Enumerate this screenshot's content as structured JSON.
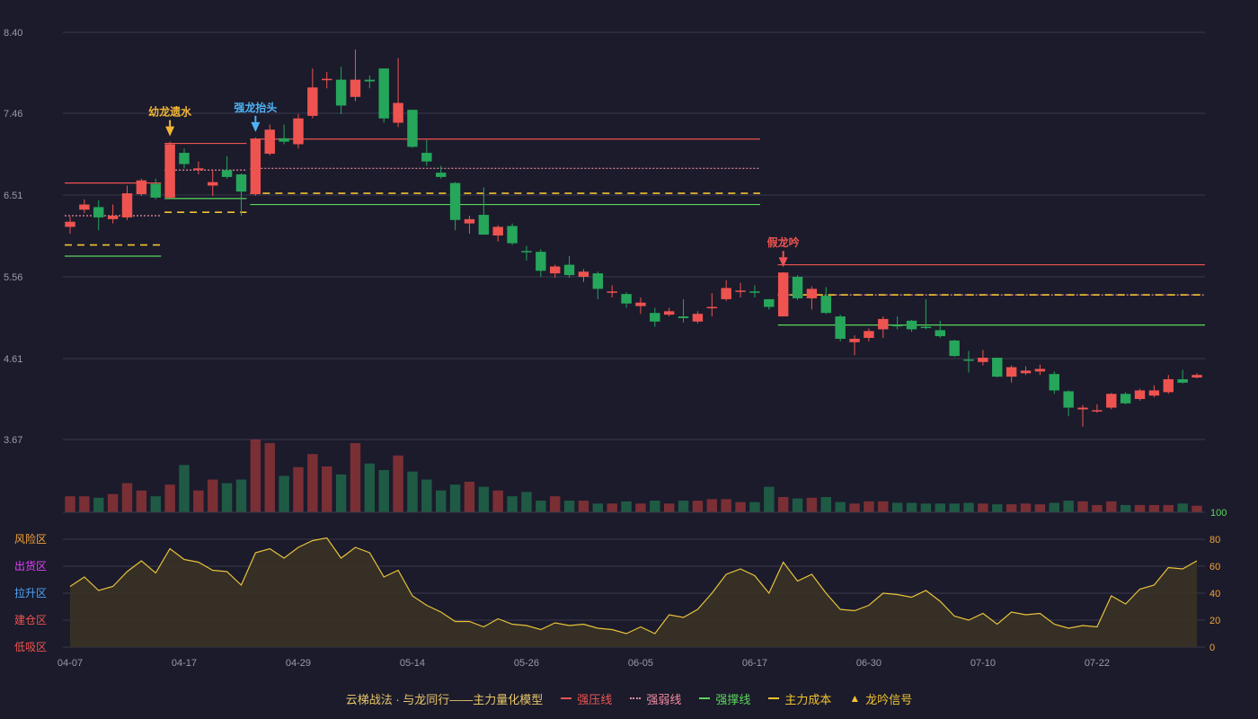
{
  "colors": {
    "bg": "#1b1b2b",
    "grid": "#3a3a4c",
    "up": "#ef5350",
    "down": "#26a65b",
    "vol_up": "#7a2f35",
    "vol_down": "#1f5a45",
    "pressure": "#ef5350",
    "weak": "#f08aa0",
    "support": "#5cd65c",
    "cost": "#f2c230",
    "osc_line": "#e8c23a",
    "osc_fill": "#3a3326",
    "signal_orange": "#f2b535",
    "signal_blue": "#4fb3f6",
    "signal_red": "#ef5350"
  },
  "chart_data": {
    "type": "candlestick",
    "x_ticks": [
      {
        "i": 0,
        "label": "04-07"
      },
      {
        "i": 8,
        "label": "04-17"
      },
      {
        "i": 16,
        "label": "04-29"
      },
      {
        "i": 24,
        "label": "05-14"
      },
      {
        "i": 32,
        "label": "05-26"
      },
      {
        "i": 40,
        "label": "06-05"
      },
      {
        "i": 48,
        "label": "06-17"
      },
      {
        "i": 56,
        "label": "06-30"
      },
      {
        "i": 64,
        "label": "07-10"
      },
      {
        "i": 72,
        "label": "07-22"
      }
    ],
    "price_axis": {
      "ticks": [
        "8.40",
        "7.46",
        "6.51",
        "5.56",
        "4.61",
        "3.67"
      ],
      "min": 3.67,
      "max": 8.4
    },
    "candles": [
      [
        6.14,
        6.2,
        6.26,
        6.06
      ],
      [
        6.34,
        6.4,
        6.46,
        6.3
      ],
      [
        6.37,
        6.25,
        6.45,
        6.1
      ],
      [
        6.23,
        6.27,
        6.4,
        6.18
      ],
      [
        6.25,
        6.53,
        6.62,
        6.22
      ],
      [
        6.52,
        6.68,
        6.7,
        6.5
      ],
      [
        6.64,
        6.48,
        6.7,
        6.46
      ],
      [
        6.48,
        7.1,
        7.13,
        6.47
      ],
      [
        7.0,
        6.87,
        7.05,
        6.82
      ],
      [
        6.8,
        6.82,
        6.9,
        6.75
      ],
      [
        6.62,
        6.66,
        6.8,
        6.5
      ],
      [
        6.8,
        6.72,
        6.96,
        6.7
      ],
      [
        6.75,
        6.55,
        6.76,
        6.27
      ],
      [
        6.52,
        7.16,
        7.18,
        6.5
      ],
      [
        6.99,
        7.27,
        7.33,
        6.97
      ],
      [
        7.17,
        7.13,
        7.33,
        7.1
      ],
      [
        7.1,
        7.4,
        7.45,
        7.05
      ],
      [
        7.43,
        7.76,
        7.98,
        7.4
      ],
      [
        7.85,
        7.86,
        7.94,
        7.75
      ],
      [
        7.85,
        7.55,
        8.0,
        7.45
      ],
      [
        7.65,
        7.85,
        8.2,
        7.6
      ],
      [
        7.85,
        7.83,
        7.9,
        7.75
      ],
      [
        7.98,
        7.4,
        7.98,
        7.35
      ],
      [
        7.35,
        7.58,
        8.1,
        7.3
      ],
      [
        7.5,
        7.07,
        7.5,
        7.06
      ],
      [
        7.0,
        6.9,
        7.15,
        6.85
      ],
      [
        6.77,
        6.72,
        6.85,
        6.7
      ],
      [
        6.65,
        6.22,
        6.66,
        6.1
      ],
      [
        6.18,
        6.23,
        6.27,
        6.06
      ],
      [
        6.28,
        6.05,
        6.6,
        6.05
      ],
      [
        6.04,
        6.14,
        6.16,
        5.97
      ],
      [
        6.15,
        5.95,
        6.18,
        5.93
      ],
      [
        5.86,
        5.85,
        5.92,
        5.75
      ],
      [
        5.85,
        5.63,
        5.88,
        5.56
      ],
      [
        5.6,
        5.68,
        5.7,
        5.55
      ],
      [
        5.7,
        5.58,
        5.8,
        5.55
      ],
      [
        5.56,
        5.62,
        5.65,
        5.5
      ],
      [
        5.6,
        5.42,
        5.62,
        5.3
      ],
      [
        5.38,
        5.39,
        5.46,
        5.32
      ],
      [
        5.36,
        5.25,
        5.38,
        5.2
      ],
      [
        5.22,
        5.26,
        5.32,
        5.13
      ],
      [
        5.14,
        5.04,
        5.2,
        4.98
      ],
      [
        5.12,
        5.16,
        5.2,
        5.1
      ],
      [
        5.1,
        5.08,
        5.3,
        5.03
      ],
      [
        5.04,
        5.13,
        5.16,
        5.02
      ],
      [
        5.2,
        5.21,
        5.37,
        5.1
      ],
      [
        5.3,
        5.43,
        5.52,
        5.28
      ],
      [
        5.39,
        5.4,
        5.49,
        5.32
      ],
      [
        5.39,
        5.38,
        5.46,
        5.32
      ],
      [
        5.3,
        5.21,
        5.3,
        5.18
      ],
      [
        5.1,
        5.61,
        5.61,
        5.1
      ],
      [
        5.56,
        5.31,
        5.58,
        5.29
      ],
      [
        5.31,
        5.42,
        5.45,
        5.18
      ],
      [
        5.34,
        5.14,
        5.44,
        5.13
      ],
      [
        5.1,
        4.84,
        5.12,
        4.81
      ],
      [
        4.8,
        4.84,
        4.88,
        4.65
      ],
      [
        4.85,
        4.93,
        4.96,
        4.81
      ],
      [
        4.95,
        5.07,
        5.1,
        4.85
      ],
      [
        5.0,
        4.99,
        5.1,
        4.95
      ],
      [
        5.05,
        4.95,
        5.06,
        4.92
      ],
      [
        4.98,
        4.97,
        5.3,
        4.95
      ],
      [
        4.94,
        4.87,
        5.05,
        4.85
      ],
      [
        4.82,
        4.64,
        4.83,
        4.63
      ],
      [
        4.6,
        4.59,
        4.7,
        4.45
      ],
      [
        4.57,
        4.62,
        4.71,
        4.53
      ],
      [
        4.62,
        4.4,
        4.62,
        4.39
      ],
      [
        4.4,
        4.51,
        4.53,
        4.33
      ],
      [
        4.44,
        4.47,
        4.52,
        4.42
      ],
      [
        4.46,
        4.49,
        4.54,
        4.42
      ],
      [
        4.43,
        4.24,
        4.46,
        4.2
      ],
      [
        4.23,
        4.04,
        4.24,
        3.94
      ],
      [
        4.02,
        4.04,
        4.07,
        3.82
      ],
      [
        4.0,
        4.01,
        4.08,
        3.98
      ],
      [
        4.04,
        4.2,
        4.21,
        4.02
      ],
      [
        4.2,
        4.09,
        4.22,
        4.08
      ],
      [
        4.14,
        4.24,
        4.26,
        4.12
      ],
      [
        4.18,
        4.24,
        4.3,
        4.16
      ],
      [
        4.22,
        4.37,
        4.42,
        4.2
      ],
      [
        4.37,
        4.33,
        4.48,
        4.32
      ],
      [
        4.39,
        4.42,
        4.44,
        4.38
      ]
    ],
    "volume": [
      22,
      22,
      20,
      25,
      40,
      30,
      22,
      38,
      65,
      30,
      45,
      40,
      45,
      100,
      95,
      50,
      62,
      80,
      63,
      52,
      95,
      67,
      58,
      78,
      56,
      45,
      30,
      38,
      42,
      35,
      30,
      22,
      28,
      16,
      22,
      16,
      16,
      12,
      12,
      15,
      12,
      16,
      12,
      16,
      16,
      18,
      18,
      14,
      14,
      35,
      21,
      19,
      20,
      21,
      14,
      12,
      15,
      15,
      13,
      13,
      12,
      12,
      12,
      13,
      12,
      11,
      11,
      12,
      11,
      13,
      16,
      15,
      10,
      15,
      10,
      10,
      10,
      10,
      12,
      9
    ],
    "volume_axis": {
      "label": "100"
    },
    "oscillator": {
      "left_labels": [
        "风险区",
        "出货区",
        "拉升区",
        "建仓区",
        "低吸区"
      ],
      "ticks": [
        "80",
        "60",
        "40",
        "20",
        "0"
      ],
      "values": [
        45,
        52,
        42,
        45,
        56,
        64,
        55,
        73,
        65,
        63,
        57,
        56,
        46,
        70,
        73,
        66,
        74,
        79,
        81,
        66,
        74,
        70,
        52,
        57,
        38,
        31,
        26,
        19,
        19,
        15,
        21,
        17,
        16,
        13,
        18,
        16,
        17,
        14,
        13,
        10,
        15,
        10,
        24,
        22,
        28,
        40,
        54,
        58,
        53,
        40,
        63,
        49,
        54,
        40,
        28,
        27,
        31,
        40,
        39,
        37,
        42,
        34,
        23,
        20,
        25,
        17,
        26,
        24,
        25,
        17,
        14,
        16,
        15,
        38,
        32,
        43,
        46,
        59,
        58,
        64
      ]
    },
    "levels": [
      {
        "type": "pressure",
        "y": 6.65,
        "from": 0,
        "to": 6,
        "style": "solid"
      },
      {
        "type": "weak",
        "y": 6.27,
        "from": 0,
        "to": 6,
        "style": "dotted"
      },
      {
        "type": "cost",
        "y": 5.93,
        "from": 0,
        "to": 6,
        "style": "dashed"
      },
      {
        "type": "support",
        "y": 5.8,
        "from": 0,
        "to": 6,
        "style": "solid"
      },
      {
        "type": "pressure",
        "y": 7.11,
        "from": 7,
        "to": 12,
        "style": "solid"
      },
      {
        "type": "weak",
        "y": 6.8,
        "from": 7,
        "to": 12,
        "style": "dotted"
      },
      {
        "type": "support",
        "y": 6.47,
        "from": 7,
        "to": 12,
        "style": "solid"
      },
      {
        "type": "cost",
        "y": 6.31,
        "from": 7,
        "to": 12,
        "style": "dashed"
      },
      {
        "type": "pressure",
        "y": 7.16,
        "from": 13,
        "to": 48,
        "style": "solid"
      },
      {
        "type": "weak",
        "y": 6.82,
        "from": 13,
        "to": 48,
        "style": "dotted"
      },
      {
        "type": "cost",
        "y": 6.53,
        "from": 13,
        "to": 48,
        "style": "dashed"
      },
      {
        "type": "support",
        "y": 6.4,
        "from": 13,
        "to": 48,
        "style": "solid"
      },
      {
        "type": "pressure",
        "y": 5.7,
        "from": 50,
        "to": 79,
        "style": "solid"
      },
      {
        "type": "weak",
        "y": 5.35,
        "from": 50,
        "to": 79,
        "style": "dotted"
      },
      {
        "type": "cost",
        "y": 5.35,
        "from": 50,
        "to": 79,
        "style": "dashed"
      },
      {
        "type": "support",
        "y": 5.0,
        "from": 50,
        "to": 79,
        "style": "solid"
      }
    ],
    "signals": [
      {
        "i": 7,
        "label": "幼龙遗水",
        "color": "orange"
      },
      {
        "i": 13,
        "label": "强龙抬头",
        "color": "blue"
      },
      {
        "i": 50,
        "label": "假龙吟",
        "color": "red"
      }
    ]
  },
  "legend": {
    "title": "云梯战法 · 与龙同行——主力量化模型",
    "items": [
      {
        "label": "强压线",
        "key": "pressure",
        "style": "solid"
      },
      {
        "label": "强弱线",
        "key": "weak",
        "style": "dotted"
      },
      {
        "label": "强撑线",
        "key": "support",
        "style": "solid"
      },
      {
        "label": "主力成本",
        "key": "cost",
        "style": "dashed"
      },
      {
        "label": "龙吟信号",
        "key": "signal",
        "style": "triangle"
      }
    ]
  }
}
